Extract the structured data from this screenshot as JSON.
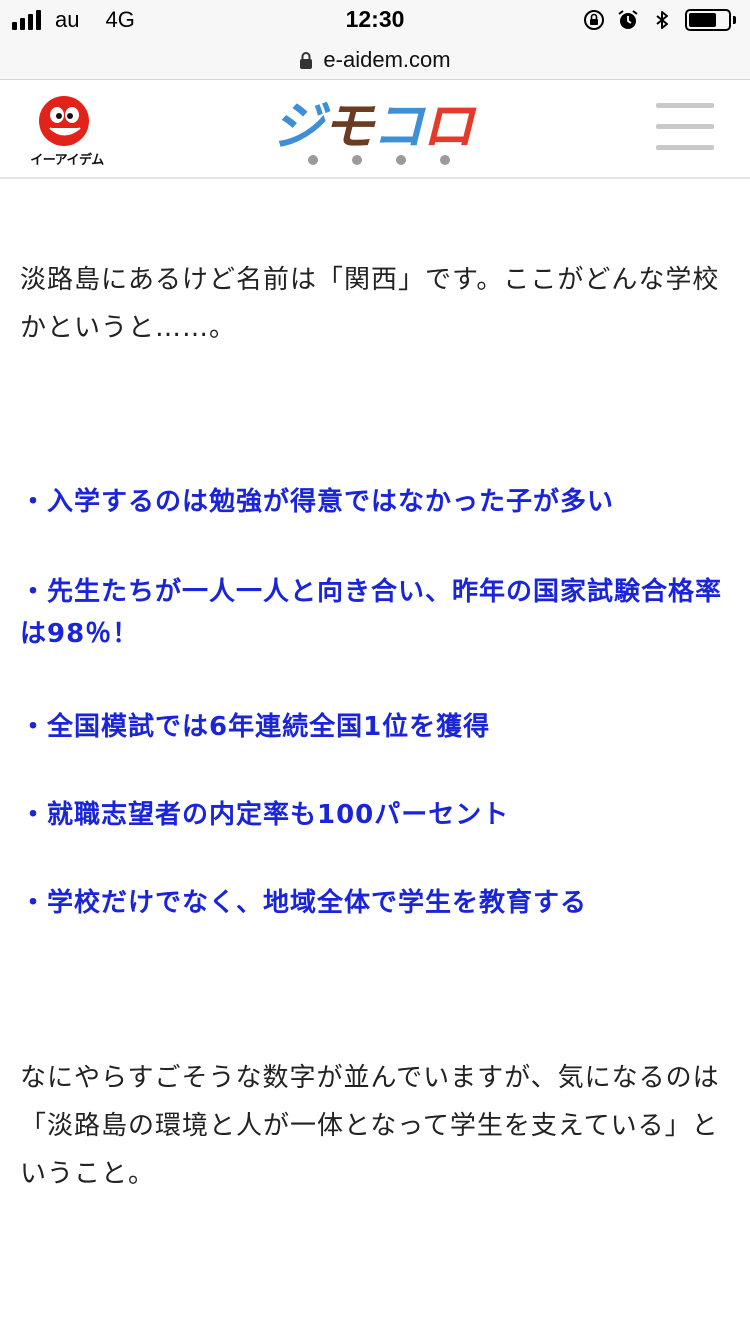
{
  "status_bar": {
    "carrier": "au",
    "network": "4G",
    "time": "12:30",
    "signal_bars": 4,
    "battery_level": 0.7,
    "icons": [
      "orientation-lock-icon",
      "alarm-icon",
      "bluetooth-icon",
      "battery-icon"
    ]
  },
  "url_bar": {
    "url": "e-aidem.com",
    "icon": "lock-icon"
  },
  "header": {
    "left_logo": {
      "mark": "e",
      "label": "イーアイデム",
      "color": "#e2231a"
    },
    "brand_logo": {
      "chars": [
        "ジ",
        "モ",
        "コ",
        "ロ"
      ],
      "colors": [
        "#3f8fd8",
        "#6b3b22",
        "#3f8fd8",
        "#e53a2a"
      ]
    },
    "menu_icon": "hamburger-menu-icon"
  },
  "article": {
    "intro": "淡路島にあるけど名前は「関西」です。ここがどんな学校かというと……。",
    "highlights": [
      "・入学するのは勉強が得意ではなかった子が多い",
      "・先生たちが一人一人と向き合い、昨年の国家試験合格率は98％！",
      "・全国模試では6年連続全国1位を獲得",
      "・就職志望者の内定率も100パーセント",
      "・学校だけでなく、地域全体で学生を教育する"
    ],
    "conclusion": "なにやらすごそうな数字が並んでいますが、気になるのは「淡路島の環境と人が一体となって学生を支えている」ということ。"
  },
  "colors": {
    "highlight_text": "#1a24d8",
    "body_text": "#222222",
    "chrome_background": "#f7f7f7"
  }
}
